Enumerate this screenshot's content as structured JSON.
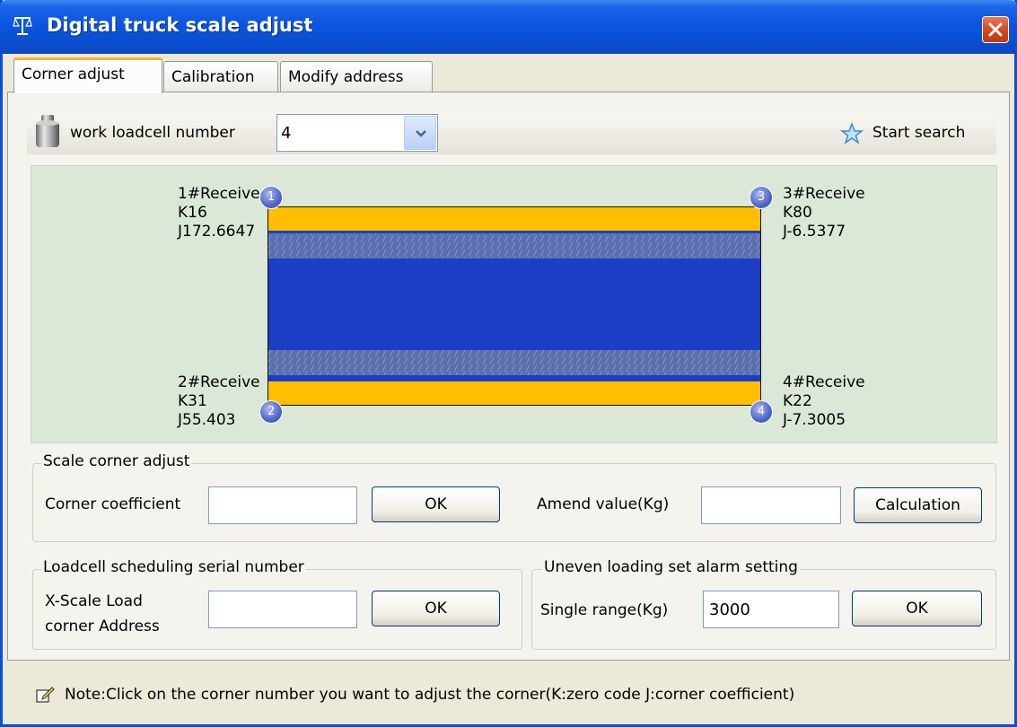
{
  "window": {
    "title": "Digital truck scale adjust"
  },
  "tabs": [
    "Corner adjust",
    "Calibration",
    "Modify address"
  ],
  "toolbar": {
    "loadcell_label": "work loadcell number",
    "loadcell_value": "4",
    "search_label": "Start search"
  },
  "corners": [
    {
      "number": "1",
      "receive": "1#Receive",
      "k": "K16",
      "j": "J172.6647"
    },
    {
      "number": "2",
      "receive": "2#Receive",
      "k": "K31",
      "j": "J55.403"
    },
    {
      "number": "3",
      "receive": "3#Receive",
      "k": "K80",
      "j": "J-6.5377"
    },
    {
      "number": "4",
      "receive": "4#Receive",
      "k": "K22",
      "j": "J-7.3005"
    }
  ],
  "scale_corner_adjust": {
    "legend": "Scale corner adjust",
    "coefficient_label": "Corner coefficient",
    "coefficient_value": "",
    "ok_label": "OK",
    "amend_label": "Amend value(Kg)",
    "amend_value": "",
    "calc_label": "Calculation"
  },
  "loadcell_scheduling": {
    "legend": "Loadcell scheduling serial number",
    "address_label_line1": "X-Scale Load",
    "address_label_line2": "corner Address",
    "address_value": "",
    "ok_label": "OK"
  },
  "uneven_loading": {
    "legend": "Uneven loading set alarm setting",
    "range_label": "Single range(Kg)",
    "range_value": "3000",
    "ok_label": "OK"
  },
  "note": "Note:Click on the corner number you want to adjust the corner(K:zero code J:corner coefficient)",
  "colors": {
    "titlebar": "#0b55df",
    "platform_blue": "#1b3fc4",
    "platform_yellow": "#ffbf00",
    "scale_bg": "#dbe8d8",
    "active_tab_accent": "#f9b034"
  }
}
